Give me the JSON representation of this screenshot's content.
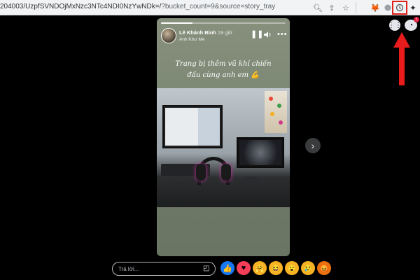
{
  "browser": {
    "url_main": "204003/UzpfSVNDOjMxNzc3NTc4NDI0NzYwNDk=/",
    "url_query": "?bucket_count=9&source=story_tray",
    "icons": [
      "search-icon",
      "share-icon",
      "star-icon",
      "metamask-icon",
      "extension-icon",
      "screen-capture-icon",
      "puzzle-icon"
    ]
  },
  "story": {
    "author": "Lê Khánh Bình",
    "time": "19 giờ",
    "subtitle": "Anh Khư Me",
    "caption": "Trang bị thêm vũ khí chiến đấu cùng anh em 💪",
    "progress": 0.25
  },
  "side": {
    "notification_count": "1"
  },
  "reply": {
    "placeholder": "Trả lời..."
  },
  "reactions": [
    {
      "name": "like",
      "glyph": "👍",
      "color": "#1877f2"
    },
    {
      "name": "love",
      "glyph": "♥",
      "color": "#f33e58"
    },
    {
      "name": "care",
      "glyph": "🤗",
      "color": "#f7b125"
    },
    {
      "name": "haha",
      "glyph": "😆",
      "color": "#f7b125"
    },
    {
      "name": "wow",
      "glyph": "😮",
      "color": "#f7b125"
    },
    {
      "name": "sad",
      "glyph": "😢",
      "color": "#f7b125"
    },
    {
      "name": "angry",
      "glyph": "😡",
      "color": "#e9710f"
    }
  ],
  "colors": {
    "highlight": "#e0201b",
    "accent": "#1877f2"
  }
}
